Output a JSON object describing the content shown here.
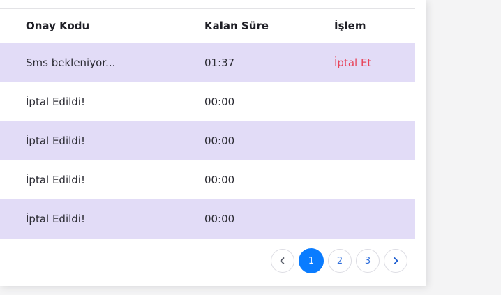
{
  "table": {
    "headers": {
      "code": "Onay Kodu",
      "remaining": "Kalan Süre",
      "action": "İşlem"
    },
    "rows": [
      {
        "code": "Sms bekleniyor...",
        "remaining": "01:37",
        "action": "İptal Et"
      },
      {
        "code": "İptal Edildi!",
        "remaining": "00:00",
        "action": ""
      },
      {
        "code": "İptal Edildi!",
        "remaining": "00:00",
        "action": ""
      },
      {
        "code": "İptal Edildi!",
        "remaining": "00:00",
        "action": ""
      },
      {
        "code": "İptal Edildi!",
        "remaining": "00:00",
        "action": ""
      }
    ]
  },
  "pagination": {
    "prev_icon": "chevron-left-icon",
    "next_icon": "chevron-right-icon",
    "pages": [
      "1",
      "2",
      "3"
    ],
    "active_page": "1"
  },
  "colors": {
    "row_alt": "#e2dcf7",
    "cancel_link": "#e8455a",
    "active_page": "#0a7cff",
    "page_text": "#2f6fdc"
  }
}
